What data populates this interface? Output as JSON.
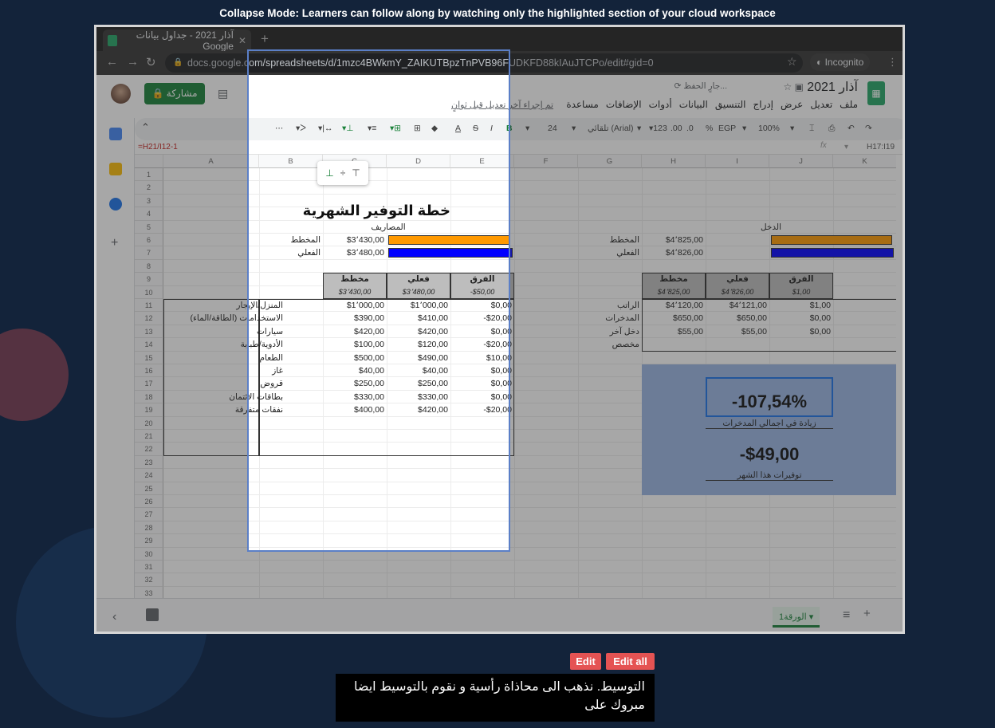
{
  "tutorial": {
    "top_caption": "Collapse Mode: Learners can follow along by watching only the highlighted section of your cloud workspace",
    "edit_label": "Edit",
    "edit_all_label": "Edit all",
    "subtitle": "التوسيط. نذهب الى محاذاة رأسية و نقوم بالتوسيط ايضا مبروك على"
  },
  "browser": {
    "tab_title": "آذار 2021 - جداول بيانات Google",
    "url": "docs.google.com/spreadsheets/d/1mzc4BWkmY_ZAIKUTBpzTnPVB96FUDKFD88kIAuJTCPo/edit#gid=0",
    "incognito_label": "Incognito"
  },
  "docs": {
    "title": "آذار 2021",
    "saving": "جارٍ الحفظ...",
    "menus": [
      "ملف",
      "تعديل",
      "عرض",
      "إدراج",
      "التنسيق",
      "البيانات",
      "أدوات",
      "الإضافات",
      "مساعدة"
    ],
    "last_edit": "تم إجراء آخر تعديل قبل ثوانٍ",
    "share_label": "مشاركة"
  },
  "toolbar": {
    "zoom": "100%",
    "currency": "EGP",
    "percent": "%",
    "decimals_less": ".0",
    "decimals_more": ".00",
    "numfmt": "123",
    "font": "تلقائي (Arial)",
    "font_size": "24"
  },
  "formula_bar": {
    "cell_ref": "H17:I19",
    "formula": "=H21/I12-1"
  },
  "grid": {
    "columns": [
      "A",
      "B",
      "C",
      "D",
      "E",
      "F",
      "G",
      "H",
      "I",
      "J",
      "K"
    ],
    "rows": [
      "1",
      "2",
      "3",
      "4",
      "5",
      "6",
      "7",
      "8",
      "9",
      "10",
      "11",
      "12",
      "13",
      "14",
      "15",
      "16",
      "17",
      "18",
      "19",
      "20",
      "21",
      "22",
      "23",
      "24",
      "25",
      "26",
      "27",
      "28",
      "29",
      "30",
      "31",
      "32",
      "33"
    ]
  },
  "sheet": {
    "title": "خطة التوفير الشهرية",
    "expenses_label": "المصاريف",
    "income_label": "الدخل",
    "planned_label": "المخطط",
    "actual_label": "الفعلي",
    "expenses_planned": "$3٬430,00",
    "expenses_actual": "$3٬480,00",
    "income_planned": "$4٬825,00",
    "income_actual": "$4٬826,00",
    "col_planned": "مخطط",
    "col_actual": "فعلي",
    "col_diff": "الفرق",
    "exp_totals": [
      "$3٬430,00",
      "$3٬480,00",
      "-$50,00"
    ],
    "inc_totals": [
      "$4٬825,00",
      "$4٬826,00",
      "$1,00"
    ],
    "expense_rows": [
      {
        "label": "المنزل/الإيجار",
        "planned": "$1٬000,00",
        "actual": "$1٬000,00",
        "diff": "$0,00"
      },
      {
        "label": "الاستخدامات (الطاقة/الماء)",
        "planned": "$390,00",
        "actual": "$410,00",
        "diff": "-$20,00"
      },
      {
        "label": "سيارات",
        "planned": "$420,00",
        "actual": "$420,00",
        "diff": "$0,00"
      },
      {
        "label": "الأدوية/طبابة",
        "planned": "$100,00",
        "actual": "$120,00",
        "diff": "-$20,00"
      },
      {
        "label": "الطعام",
        "planned": "$500,00",
        "actual": "$490,00",
        "diff": "$10,00"
      },
      {
        "label": "غاز",
        "planned": "$40,00",
        "actual": "$40,00",
        "diff": "$0,00"
      },
      {
        "label": "قروض",
        "planned": "$250,00",
        "actual": "$250,00",
        "diff": "$0,00"
      },
      {
        "label": "بطاقات الائتمان",
        "planned": "$330,00",
        "actual": "$330,00",
        "diff": "$0,00"
      },
      {
        "label": "نفقات متفرقة",
        "planned": "$400,00",
        "actual": "$420,00",
        "diff": "-$20,00"
      }
    ],
    "income_rows": [
      {
        "label": "الراتب",
        "planned": "$4٬120,00",
        "actual": "$4٬121,00",
        "diff": "$1,00"
      },
      {
        "label": "المدخرات",
        "planned": "$650,00",
        "actual": "$650,00",
        "diff": "$0,00"
      },
      {
        "label": "دخل آخر",
        "planned": "$55,00",
        "actual": "$55,00",
        "diff": "$0,00"
      },
      {
        "label": "مخصص",
        "planned": "",
        "actual": "",
        "diff": ""
      }
    ],
    "savings_pct": "-107,54%",
    "savings_pct_label": "زيادة في اجمالي المدخرات",
    "savings_amount": "-$49,00",
    "savings_amount_label": "توفيرات هذا الشهر",
    "bar_colors": {
      "planned": "#ff9900",
      "actual": "#0000ff"
    }
  },
  "footer": {
    "sheet_tab": "الورقة1"
  },
  "colors": {
    "accent": "#188038",
    "highlight": "#1a73e8",
    "background": "#13233a"
  }
}
